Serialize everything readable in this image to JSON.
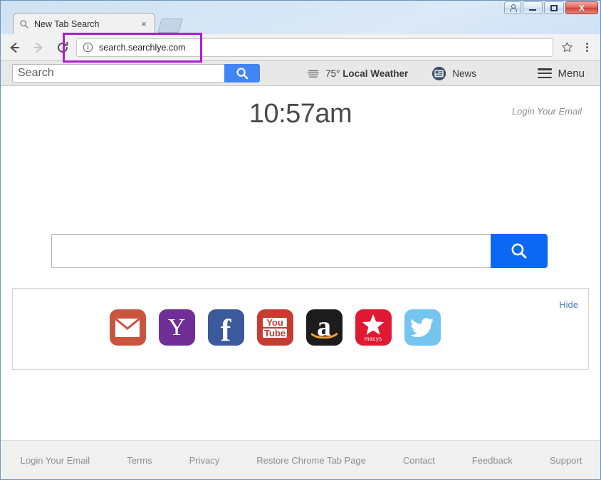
{
  "window": {
    "controls": [
      {
        "name": "user-account",
        "glyph": "user"
      },
      {
        "name": "minimize",
        "glyph": "minimize"
      },
      {
        "name": "maximize",
        "glyph": "maximize"
      },
      {
        "name": "close",
        "glyph": "X"
      }
    ]
  },
  "browser": {
    "tab": {
      "title": "New Tab Search",
      "favicon": "search-icon",
      "close_label": "×"
    },
    "nav": {
      "back": "back-arrow-icon",
      "forward": "forward-arrow-icon",
      "reload": "reload-icon"
    },
    "omnibox": {
      "url": "search.searchlye.com",
      "security_icon": "info-circle-icon",
      "star_icon": "star-icon",
      "menu_icon": "three-dots-icon"
    }
  },
  "annotation": {
    "color": "#b11ad6",
    "target": "address-bar"
  },
  "sitebar": {
    "search_placeholder": "Search",
    "search_value": "",
    "search_button_icon": "magnifier-icon",
    "search_button_color": "#4285f4",
    "weather_icon": "weather-icon",
    "weather_temp": "75°",
    "weather_label": "Local Weather",
    "news_icon": "newspaper-icon",
    "news_label": "News",
    "menu_icon": "hamburger-icon",
    "menu_label": "Menu"
  },
  "page": {
    "clock": "10:57am",
    "login_email_top": "Login Your Email",
    "search": {
      "value": "",
      "placeholder": "",
      "button_icon": "magnifier-icon",
      "button_color": "#0b68f5"
    },
    "shortcuts": {
      "hide_label": "Hide",
      "tiles": [
        {
          "name": "gmail",
          "label": "Gmail",
          "color": "#c9553f"
        },
        {
          "name": "yahoo",
          "label": "Y",
          "color": "#6f2f96"
        },
        {
          "name": "facebook",
          "label": "f",
          "color": "#3b5a9b"
        },
        {
          "name": "youtube",
          "label_top": "You",
          "label_bottom": "Tube",
          "color": "#c63c30"
        },
        {
          "name": "amazon",
          "label": "a",
          "color": "#1c1c1c"
        },
        {
          "name": "macys",
          "label": "macys",
          "color": "#e01933"
        },
        {
          "name": "twitter",
          "label": "Twitter",
          "color": "#74c4ef"
        }
      ]
    },
    "footer_links": [
      "Login Your Email",
      "Terms",
      "Privacy",
      "Restore Chrome Tab Page",
      "Contact",
      "Feedback",
      "Support"
    ]
  }
}
